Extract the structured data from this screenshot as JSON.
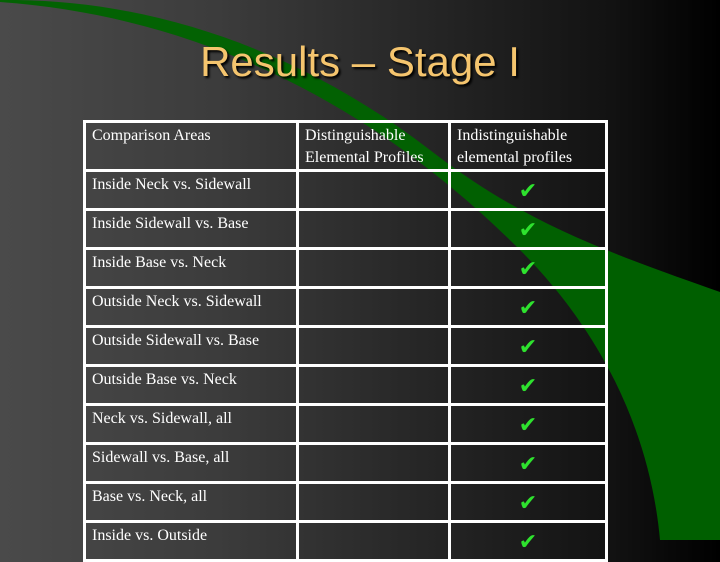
{
  "slide": {
    "title": "Results – Stage I",
    "colors": {
      "title": "#f5c56e",
      "arc": "#006400",
      "check": "#2ee22e"
    }
  },
  "table": {
    "headers": [
      "Comparison Areas",
      "Distinguishable Elemental Profiles",
      "Indistinguishable elemental profiles"
    ],
    "header_lines": {
      "col2": [
        "Distinguishable",
        "Elemental Profiles"
      ],
      "col3": [
        "Indistinguishable",
        "elemental profiles"
      ]
    },
    "rows": [
      {
        "area": "Inside Neck vs. Sidewall",
        "distinguishable": "",
        "indistinguishable": "✔"
      },
      {
        "area": "Inside Sidewall vs. Base",
        "distinguishable": "",
        "indistinguishable": "✔"
      },
      {
        "area": "Inside Base vs. Neck",
        "distinguishable": "",
        "indistinguishable": "✔"
      },
      {
        "area": "Outside Neck vs. Sidewall",
        "distinguishable": "",
        "indistinguishable": "✔"
      },
      {
        "area": "Outside Sidewall vs. Base",
        "distinguishable": "",
        "indistinguishable": "✔"
      },
      {
        "area": "Outside Base vs. Neck",
        "distinguishable": "",
        "indistinguishable": "✔"
      },
      {
        "area": "Neck vs. Sidewall, all",
        "distinguishable": "",
        "indistinguishable": "✔"
      },
      {
        "area": "Sidewall vs. Base, all",
        "distinguishable": "",
        "indistinguishable": "✔"
      },
      {
        "area": "Base vs. Neck, all",
        "distinguishable": "",
        "indistinguishable": "✔"
      },
      {
        "area": "Inside vs. Outside",
        "distinguishable": "",
        "indistinguishable": "✔"
      }
    ]
  }
}
